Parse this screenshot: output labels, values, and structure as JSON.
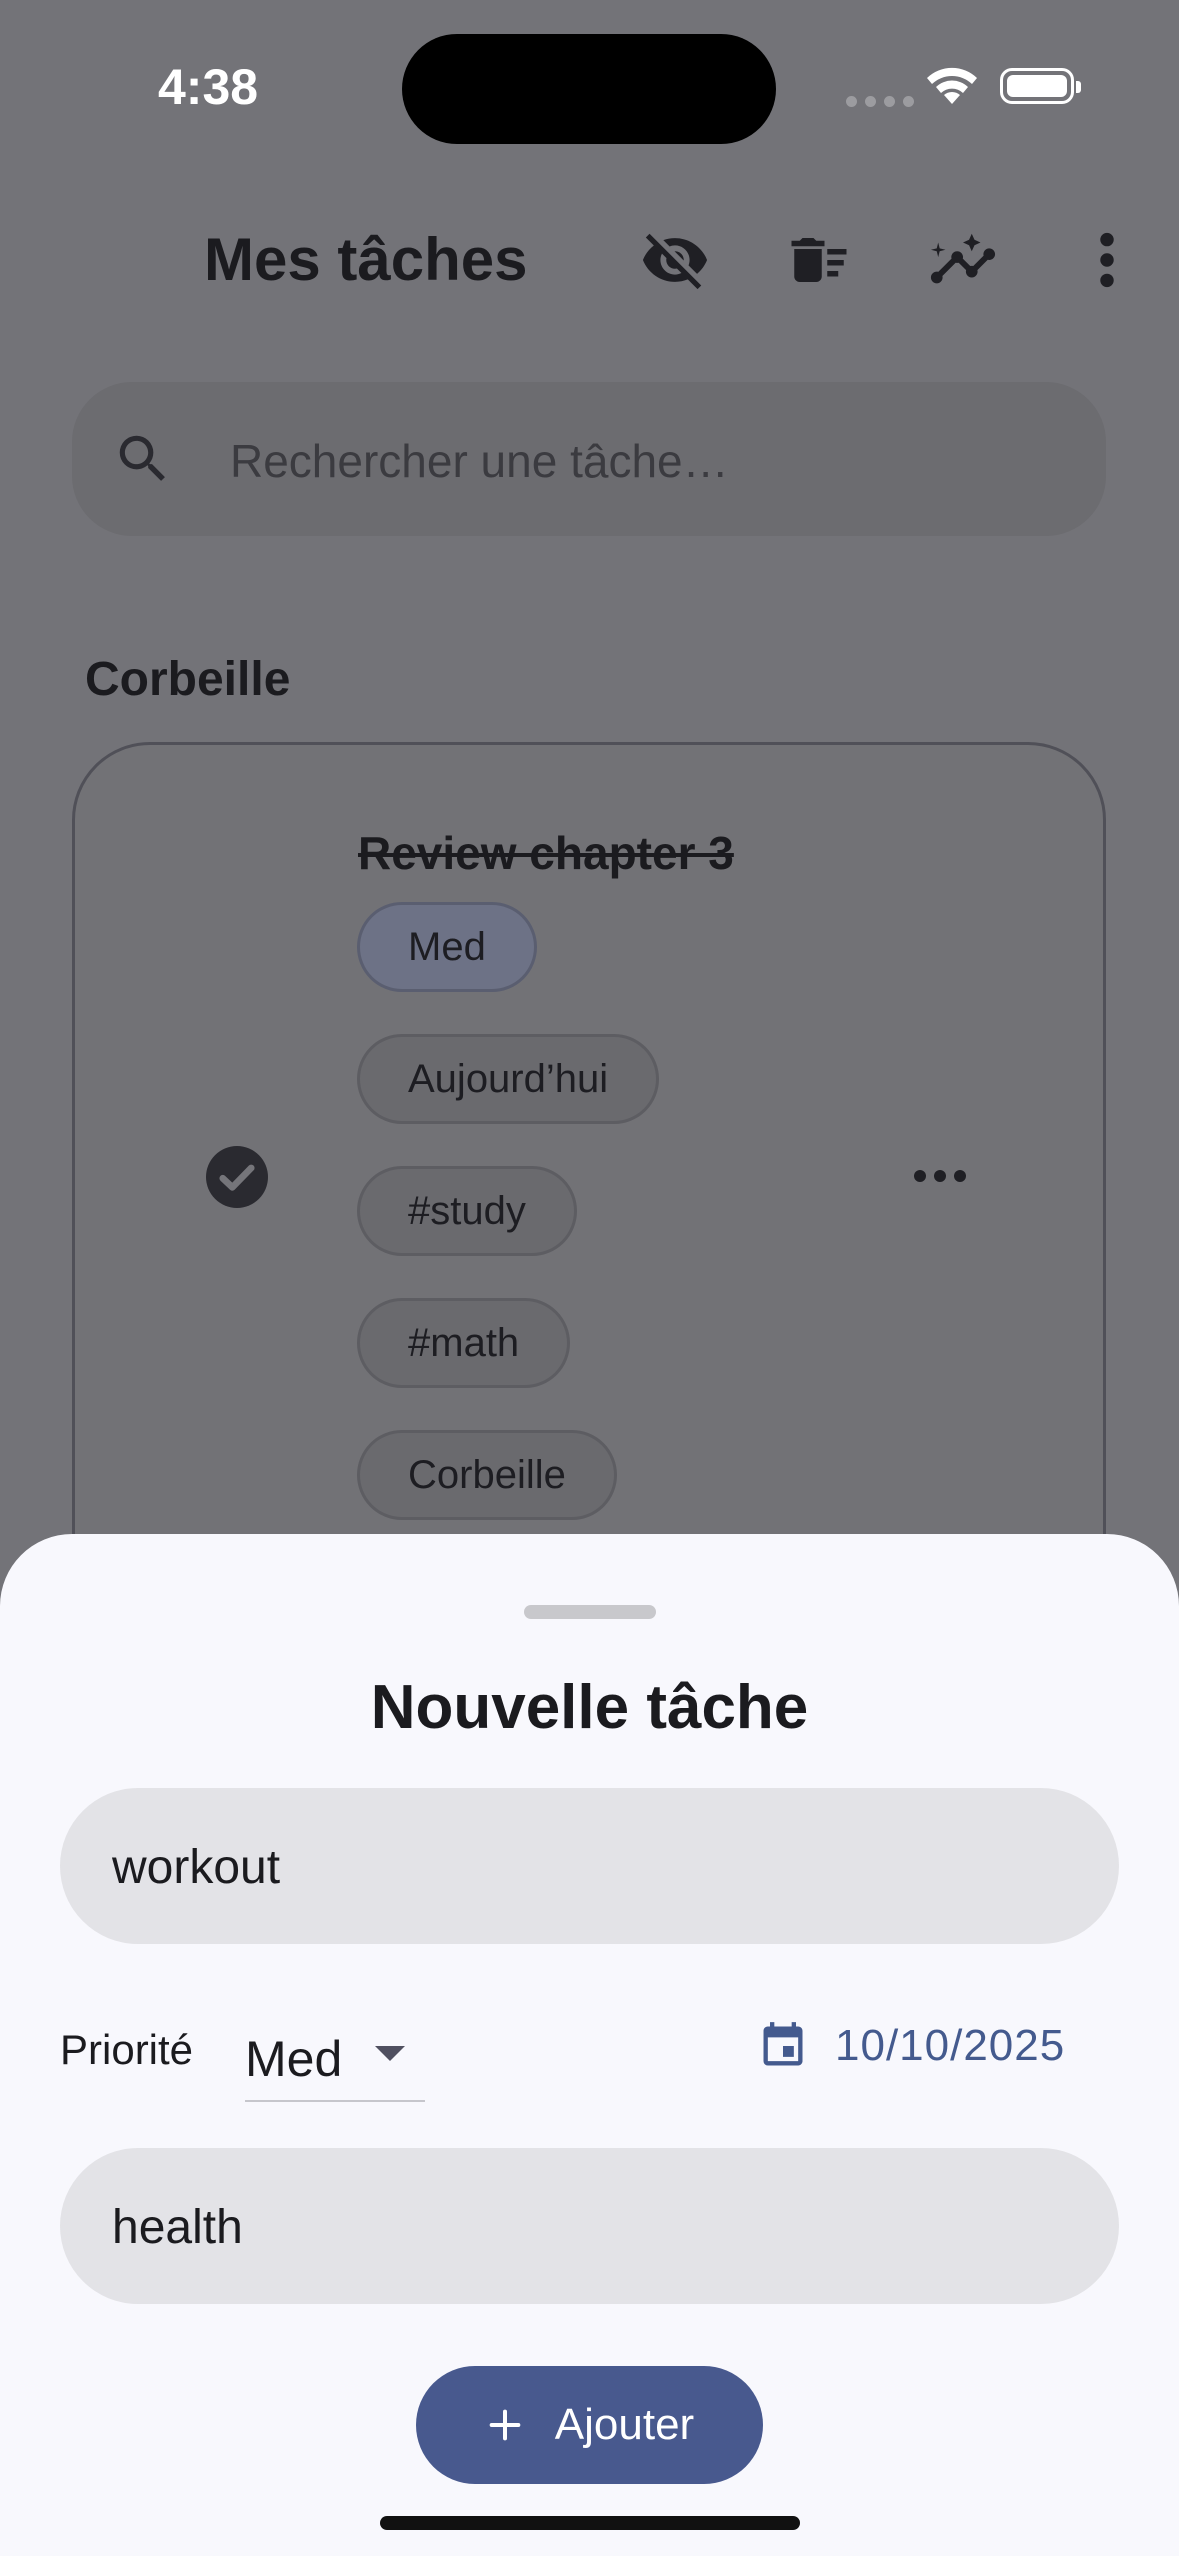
{
  "status_bar": {
    "time": "4:38"
  },
  "app_bar": {
    "title": "Mes tâches",
    "icons": [
      "eye-off-icon",
      "delete-sweep-icon",
      "insights-icon",
      "more-vert-icon"
    ]
  },
  "search": {
    "placeholder": "Rechercher une tâche…"
  },
  "section_title": "Corbeille",
  "task": {
    "title": "Review chapter 3",
    "completed": true,
    "chips": [
      "Med",
      "Aujourd’hui",
      "#study",
      "#math",
      "Corbeille"
    ]
  },
  "sheet": {
    "title": "Nouvelle tâche",
    "title_field_value": "workout",
    "priority_label": "Priorité",
    "priority_value": "Med",
    "date": "10/10/2025",
    "tags_field_value": "health",
    "add_label": "Ajouter"
  },
  "colors": {
    "primary": "#48598e",
    "sheet_bg": "#f8f8fd",
    "field_bg": "#e3e3e7"
  }
}
